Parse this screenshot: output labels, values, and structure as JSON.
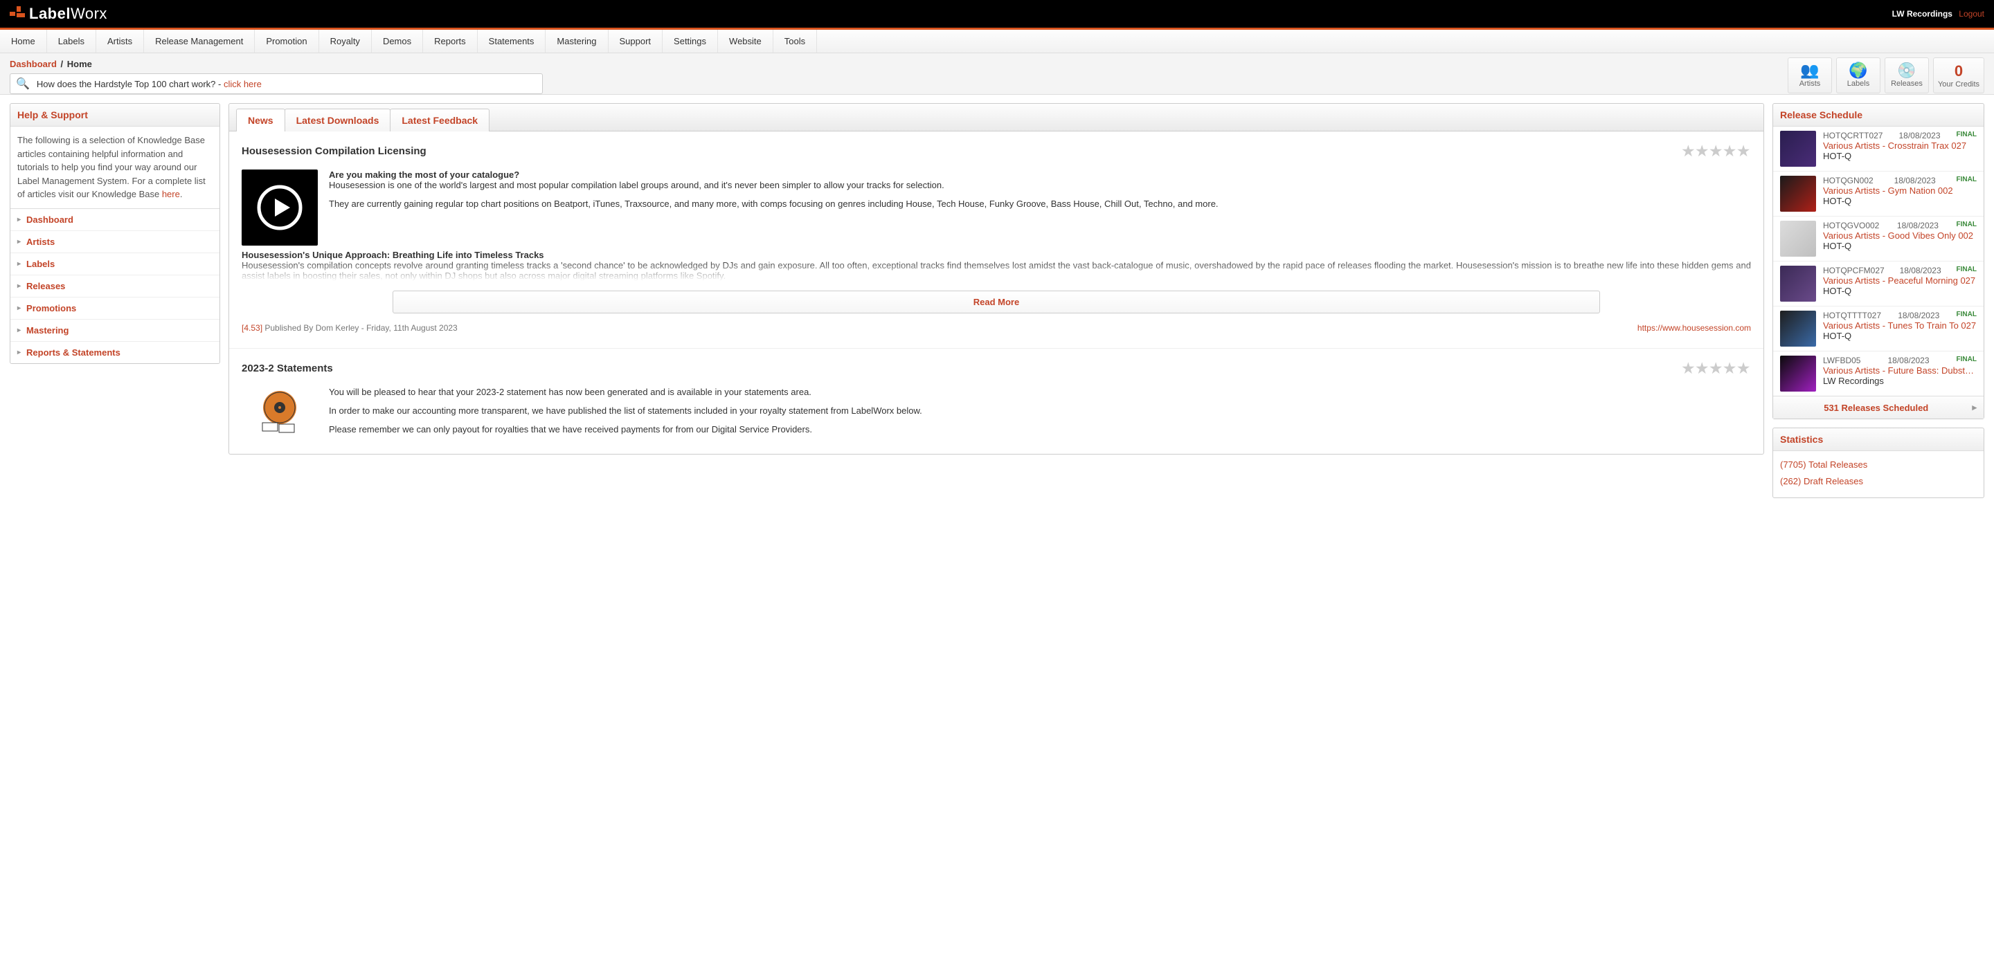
{
  "topbar": {
    "logo_a": "Label",
    "logo_b": "Worx",
    "account": "LW Recordings",
    "logout": "Logout"
  },
  "nav": [
    "Home",
    "Labels",
    "Artists",
    "Release Management",
    "Promotion",
    "Royalty",
    "Demos",
    "Reports",
    "Statements",
    "Mastering",
    "Support",
    "Settings",
    "Website",
    "Tools"
  ],
  "breadcrumb": {
    "root": "Dashboard",
    "sep": "/",
    "cur": "Home"
  },
  "search": {
    "text": "How does the Hardstyle Top 100 chart work? - ",
    "link": "click here"
  },
  "tiles": {
    "artists": "Artists",
    "labels": "Labels",
    "releases": "Releases",
    "credits_num": "0",
    "credits_lbl": "Your Credits"
  },
  "help": {
    "title": "Help & Support",
    "text": "The following is a selection of Knowledge Base articles containing helpful information and tutorials to help you find your way around our Label Management System. For a complete list of articles visit our Knowledge Base ",
    "link": "here",
    "dot": "."
  },
  "side_items": [
    "Dashboard",
    "Artists",
    "Labels",
    "Releases",
    "Promotions",
    "Mastering",
    "Reports & Statements"
  ],
  "tabs": [
    "News",
    "Latest Downloads",
    "Latest Feedback"
  ],
  "article1": {
    "title": "Housesession Compilation Licensing",
    "lead_bold": "Are you making the most of your catalogue?",
    "lead": "Housesession is one of the world's largest and most popular compilation label groups around, and it's never been simpler to allow your tracks for selection.",
    "p2": "They are currently gaining regular top chart positions on Beatport, iTunes, Traxsource, and many more, with comps focusing on genres including House, Tech House, Funky Groove, Bass House, Chill Out, Techno, and more.",
    "sub": "Housesession's Unique Approach: Breathing Life into Timeless Tracks",
    "p3": "Housesession's compilation concepts revolve around granting timeless tracks a 'second chance' to be acknowledged by DJs and gain exposure. All too often, exceptional tracks find themselves lost amidst the vast back-catalogue of music, overshadowed by the rapid pace of releases flooding the market. Housesession's mission is to breathe new life into these hidden gems and assist labels in boosting their sales, not only within DJ shops but also across major digital streaming platforms like Spotify.",
    "readmore": "Read More",
    "rating": "[4.53]",
    "byline": " Published By Dom Kerley - Friday, 11th August 2023",
    "url": "https://www.housesession.com"
  },
  "article2": {
    "title": "2023-2 Statements",
    "p1": "You will be pleased to hear that your 2023-2 statement has now been generated and is available in your statements area.",
    "p2": "In order to make our accounting more transparent, we have published the list of statements included in your royalty statement from LabelWorx below.",
    "p3": "Please remember we can only payout for royalties that we have received payments for from our Digital Service Providers."
  },
  "schedule": {
    "title": "Release Schedule",
    "items": [
      {
        "code": "HOTQCRTT027",
        "date": "18/08/2023",
        "status": "FINAL",
        "title": "Various Artists - Crosstrain Trax 027",
        "label": "HOT-Q",
        "c1": "#2a1e4f",
        "c2": "#4a2c78"
      },
      {
        "code": "HOTQGN002",
        "date": "18/08/2023",
        "status": "FINAL",
        "title": "Various Artists - Gym Nation 002",
        "label": "HOT-Q",
        "c1": "#1a1a1a",
        "c2": "#b02018"
      },
      {
        "code": "HOTQGVO002",
        "date": "18/08/2023",
        "status": "FINAL",
        "title": "Various Artists - Good Vibes Only 002",
        "label": "HOT-Q",
        "c1": "#dcdcdc",
        "c2": "#bfbfbf"
      },
      {
        "code": "HOTQPCFM027",
        "date": "18/08/2023",
        "status": "FINAL",
        "title": "Various Artists - Peaceful Morning 027",
        "label": "HOT-Q",
        "c1": "#3b2a56",
        "c2": "#6a4a8a"
      },
      {
        "code": "HOTQTTTT027",
        "date": "18/08/2023",
        "status": "FINAL",
        "title": "Various Artists - Tunes To Train To 027",
        "label": "HOT-Q",
        "c1": "#1e1e1e",
        "c2": "#3a6aa8"
      },
      {
        "code": "LWFBD05",
        "date": "18/08/2023",
        "status": "FINAL",
        "title": "Various Artists - Future Bass: Dubstep, Vol.",
        "label": "LW Recordings",
        "c1": "#0a0a0a",
        "c2": "#a020c0"
      }
    ],
    "footer": "531 Releases Scheduled"
  },
  "stats": {
    "title": "Statistics",
    "rows": [
      "(7705) Total Releases",
      "(262) Draft Releases"
    ]
  }
}
